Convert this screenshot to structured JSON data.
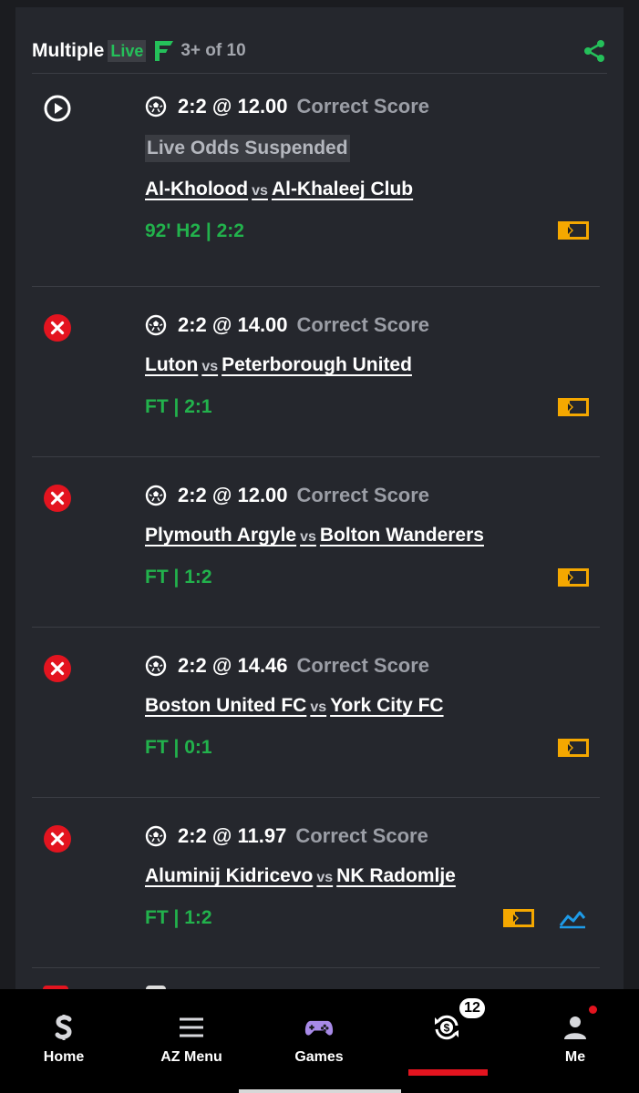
{
  "header": {
    "title": "Multiple",
    "live_label": "Live",
    "count": "3+ of 10"
  },
  "colors": {
    "live_green": "#25c05a",
    "score_green": "#22b24c",
    "lost_red": "#e3141f",
    "stream_orange": "#f5a800",
    "stats_blue": "#1e9be8"
  },
  "bets": [
    {
      "status": "live",
      "status_icon": "play-circle-icon",
      "pick": "2:2 @ 12.00",
      "market": "Correct Score",
      "notice": "Live Odds Suspended",
      "home": "Al-Kholood",
      "vs": "vs",
      "away": "Al-Khaleej Club",
      "score": "92' H2 | 2:2"
    },
    {
      "status": "lost",
      "status_icon": "lost-x-icon",
      "pick": "2:2 @ 14.00",
      "market": "Correct Score",
      "home": "Luton",
      "vs": "vs",
      "away": "Peterborough United",
      "score": "FT | 2:1"
    },
    {
      "status": "lost",
      "status_icon": "lost-x-icon",
      "pick": "2:2 @ 12.00",
      "market": "Correct Score",
      "home": "Plymouth Argyle",
      "vs": "vs",
      "away": "Bolton Wanderers",
      "score": "FT | 1:2"
    },
    {
      "status": "lost",
      "status_icon": "lost-x-icon",
      "pick": "2:2 @ 14.46",
      "market": "Correct Score",
      "home": "Boston United FC",
      "vs": "vs",
      "away": "York City FC",
      "score": "FT | 0:1"
    },
    {
      "status": "lost",
      "status_icon": "lost-x-icon",
      "pick": "2:2 @ 11.97",
      "market": "Correct Score",
      "home": "Aluminij Kidricevo",
      "vs": "vs",
      "away": "NK Radomlje",
      "score": "FT | 1:2"
    }
  ],
  "nav": {
    "home": "Home",
    "az_menu": "AZ Menu",
    "games": "Games",
    "my_bets_badge": "12",
    "me": "Me"
  }
}
